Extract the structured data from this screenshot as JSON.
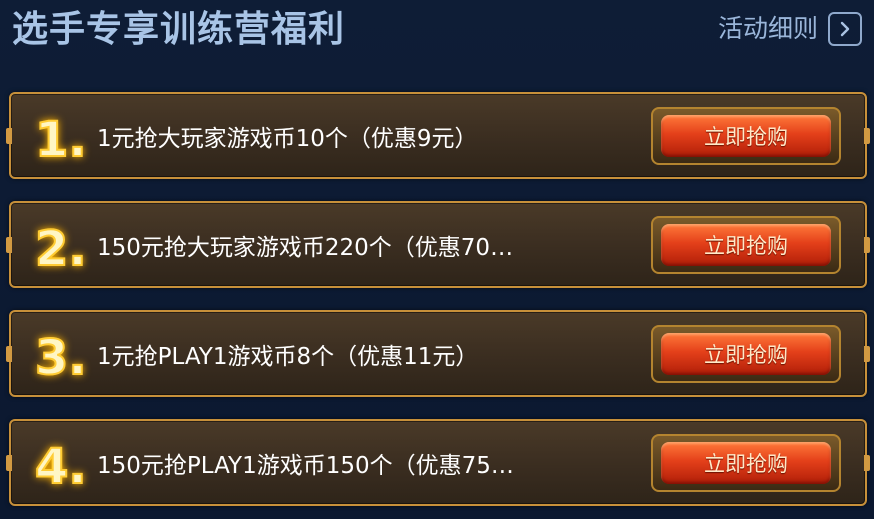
{
  "header": {
    "title": "选手专享训练营福利",
    "rules_label": "活动细则",
    "rules_icon": "chevron-right-icon"
  },
  "offers": [
    {
      "number": "1.",
      "text": "1元抢大玩家游戏币10个（优惠9元）",
      "button_label": "立即抢购"
    },
    {
      "number": "2.",
      "text": "150元抢大玩家游戏币220个（优惠70…",
      "button_label": "立即抢购"
    },
    {
      "number": "3.",
      "text": "1元抢PLAY1游戏币8个（优惠11元）",
      "button_label": "立即抢购"
    },
    {
      "number": "4.",
      "text": "150元抢PLAY1游戏币150个（优惠75…",
      "button_label": "立即抢购"
    }
  ],
  "colors": {
    "background": "#0c1a30",
    "title": "#a8c4e6",
    "card_border": "#c7903a",
    "number_glow": "#ffd24a",
    "button": "#e4401a"
  }
}
